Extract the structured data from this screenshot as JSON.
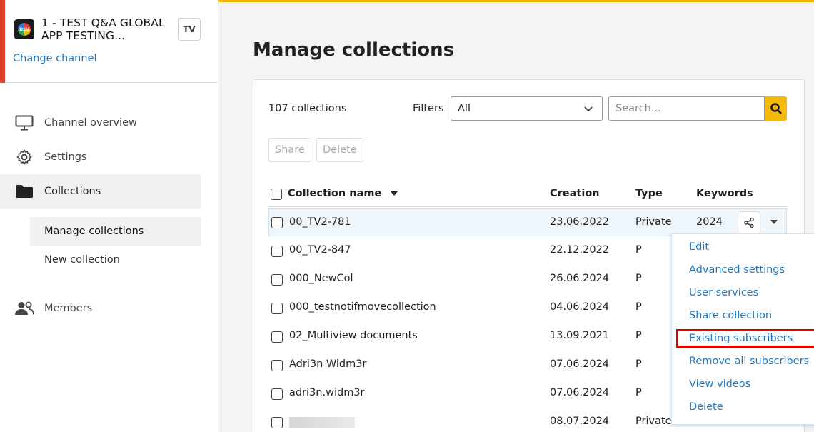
{
  "channel": {
    "name": "1 - TEST Q&A GLOBAL APP TESTING...",
    "badge": "TV",
    "change_label": "Change channel"
  },
  "nav": {
    "items": [
      {
        "label": "Channel overview",
        "icon": "monitor-icon"
      },
      {
        "label": "Settings",
        "icon": "gear-icon"
      },
      {
        "label": "Collections",
        "icon": "folder-icon"
      },
      {
        "label": "Members",
        "icon": "people-icon"
      }
    ],
    "sub_items": [
      {
        "label": "Manage collections"
      },
      {
        "label": "New collection"
      }
    ]
  },
  "page": {
    "title": "Manage collections"
  },
  "toolbar": {
    "count": "107  collections",
    "filters_label": "Filters",
    "filter_value": "All",
    "search_placeholder": "Search...",
    "share_label": "Share",
    "delete_label": "Delete"
  },
  "table": {
    "headers": {
      "name": "Collection name",
      "creation": "Creation",
      "type": "Type",
      "keywords": "Keywords"
    },
    "rows": [
      {
        "name": "00_TV2-781",
        "creation": "23.06.2022",
        "type": "Private",
        "keywords": "2024"
      },
      {
        "name": "00_TV2-847",
        "creation": "22.12.2022",
        "type": "P"
      },
      {
        "name": "000_NewCol",
        "creation": "26.06.2024",
        "type": "P"
      },
      {
        "name": "000_testnotifmovecollection",
        "creation": "04.06.2024",
        "type": "P"
      },
      {
        "name": "02_Multiview documents",
        "creation": "13.09.2021",
        "type": "P"
      },
      {
        "name": "Adri3n Widm3r",
        "creation": "07.06.2024",
        "type": "P"
      },
      {
        "name": "adri3n.widm3r",
        "creation": "07.06.2024",
        "type": "P"
      },
      {
        "name": "",
        "creation": "08.07.2024",
        "type": "Private"
      }
    ]
  },
  "menu": {
    "items": [
      "Edit",
      "Advanced settings",
      "User services",
      "Share collection",
      "Existing subscribers",
      "Remove all subscribers",
      "View videos",
      "Delete"
    ],
    "highlighted": "Existing subscribers"
  },
  "colors": {
    "accent": "#f5b90a",
    "link": "#1f78c1",
    "highlight_box": "#e00000",
    "channel_accent": "#e1412f"
  }
}
